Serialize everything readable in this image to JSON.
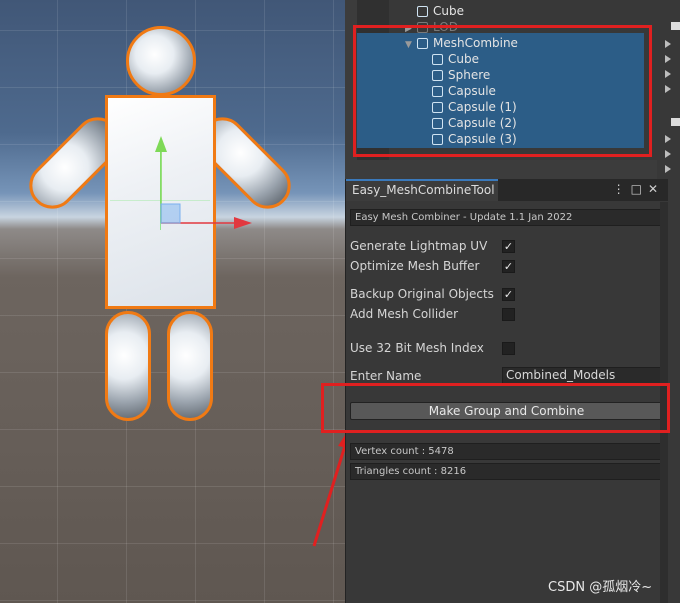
{
  "hierarchy": {
    "items": [
      {
        "label": "Cube",
        "dim": false
      },
      {
        "label": "LOD",
        "dim": true
      },
      {
        "label": "MeshCombine",
        "dim": false
      },
      {
        "label": "Cube",
        "dim": false
      },
      {
        "label": "Sphere",
        "dim": false
      },
      {
        "label": "Capsule",
        "dim": false
      },
      {
        "label": "Capsule (1)",
        "dim": false
      },
      {
        "label": "Capsule (2)",
        "dim": false
      },
      {
        "label": "Capsule (3)",
        "dim": false
      }
    ]
  },
  "tool": {
    "tab_title": "Easy_MeshCombineTool",
    "header": "Easy Mesh Combiner - Update 1.1 Jan 2022",
    "options": [
      {
        "label": "Generate Lightmap UV",
        "checked": true
      },
      {
        "label": "Optimize Mesh Buffer",
        "checked": true
      },
      {
        "label": "Backup Original Objects",
        "checked": true
      },
      {
        "label": "Add Mesh Collider",
        "checked": false
      },
      {
        "label": "Use 32 Bit Mesh Index",
        "checked": false
      }
    ],
    "name_label": "Enter Name",
    "name_value": "Combined_Models",
    "combine_button": "Make Group and Combine",
    "vertex_count": "Vertex count : 5478",
    "triangles_count": "Triangles count : 8216"
  },
  "watermark": "CSDN @孤烟冷~",
  "colors": {
    "selection": "#2c5d87",
    "highlight_box": "#e02020",
    "outline": "#f07a14"
  }
}
